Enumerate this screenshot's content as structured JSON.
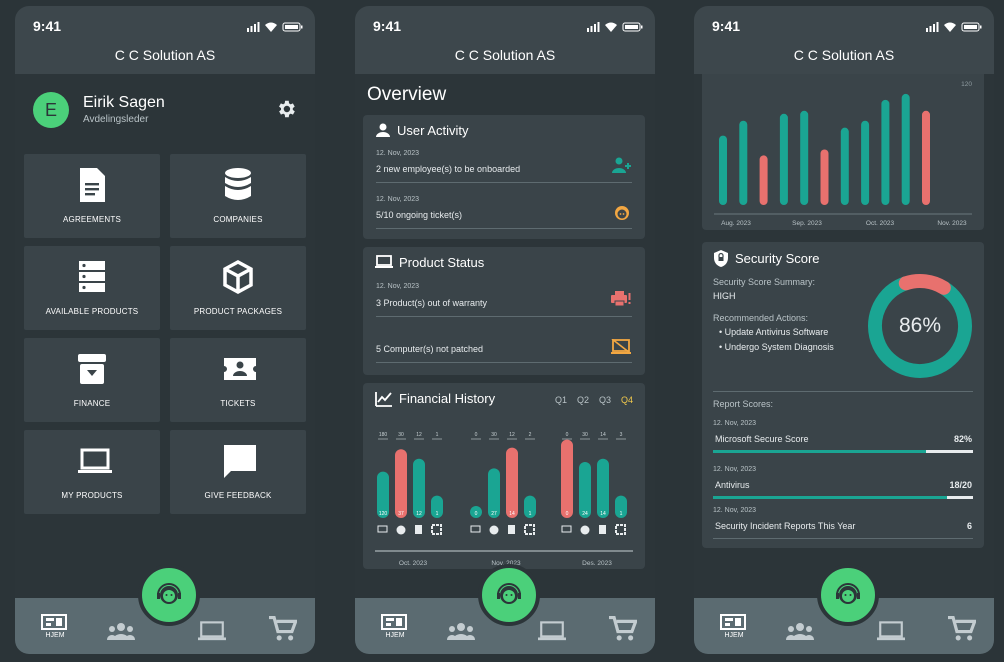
{
  "status": {
    "time": "9:41"
  },
  "header": {
    "company": "C C Solution AS"
  },
  "nav": {
    "home_label": "HJEM"
  },
  "colors": {
    "accent": "#1aa593",
    "alert": "#e8716e",
    "fab": "#4bd07a",
    "icon_warn": "#f2a742"
  },
  "screen1": {
    "user": {
      "initial": "E",
      "name": "Eirik Sagen",
      "role": "Avdelingsleder"
    },
    "tiles": [
      {
        "label": "AGREEMENTS",
        "icon": "document-icon"
      },
      {
        "label": "COMPANIES",
        "icon": "database-icon"
      },
      {
        "label": "AVAILABLE PRODUCTS",
        "icon": "server-icon"
      },
      {
        "label": "PRODUCT PACKAGES",
        "icon": "package-icon"
      },
      {
        "label": "FINANCE",
        "icon": "archive-icon"
      },
      {
        "label": "TICKETS",
        "icon": "ticket-icon"
      },
      {
        "label": "MY PRODUCTS",
        "icon": "laptop-icon"
      },
      {
        "label": "GIVE FEEDBACK",
        "icon": "chat-icon"
      }
    ]
  },
  "screen2": {
    "title": "Overview",
    "user_activity": {
      "title": "User Activity",
      "items": [
        {
          "date": "12. Nov, 2023",
          "text": "2 new employee(s) to be onboarded"
        },
        {
          "date": "12. Nov, 2023",
          "text": "5/10 ongoing ticket(s)"
        }
      ]
    },
    "product_status": {
      "title": "Product Status",
      "items": [
        {
          "date": "12. Nov, 2023",
          "text": "3 Product(s) out of warranty"
        },
        {
          "date": "",
          "text": "5 Computer(s) not patched"
        }
      ]
    },
    "financial": {
      "title": "Financial History",
      "quarters": [
        "Q1",
        "Q2",
        "Q3",
        "Q4"
      ],
      "active_quarter": "Q4",
      "months": [
        "Oct. 2023",
        "Nov. 2023",
        "Des. 2023"
      ],
      "groups": [
        {
          "tops": [
            "180",
            "30",
            "12",
            "1"
          ],
          "bottoms": [
            "120",
            "37",
            "12",
            "1"
          ],
          "heights": [
            0.58,
            0.86,
            0.74,
            0.28
          ],
          "colors": [
            "t",
            "r",
            "t",
            "t"
          ]
        },
        {
          "tops": [
            "0",
            "30",
            "12",
            "2"
          ],
          "bottoms": [
            "0",
            "27",
            "14",
            "1"
          ],
          "heights": [
            0.05,
            0.62,
            0.88,
            0.28
          ],
          "colors": [
            "t",
            "t",
            "r",
            "t"
          ]
        },
        {
          "tops": [
            "0",
            "30",
            "14",
            "3"
          ],
          "bottoms": [
            "0",
            "24",
            "14",
            "1"
          ],
          "heights": [
            0.98,
            0.7,
            0.74,
            0.28
          ],
          "colors": [
            "r",
            "t",
            "t",
            "t"
          ]
        }
      ]
    }
  },
  "screen3": {
    "chart_data": {
      "type": "bar",
      "ylim": [
        0,
        120
      ],
      "ytick": "120",
      "x_labels": [
        "Aug. 2023",
        "Sep. 2023",
        "Oct. 2023",
        "Nov. 2023"
      ],
      "values": [
        70,
        85,
        50,
        92,
        95,
        56,
        78,
        85,
        106,
        112,
        95
      ],
      "colors": [
        "t",
        "t",
        "r",
        "t",
        "t",
        "r",
        "t",
        "t",
        "t",
        "t",
        "r"
      ]
    },
    "security": {
      "title": "Security Score",
      "summary_label": "Security Score Summary:",
      "summary_value": "HIGH",
      "actions_label": "Recommended Actions:",
      "actions": [
        "Update Antivirus Software",
        "Undergo System Diagnosis"
      ],
      "score_text": "86%",
      "score_fraction": 0.86,
      "report_label": "Report Scores:",
      "reports": [
        {
          "date": "12. Nov, 2023",
          "name": "Microsoft Secure Score",
          "value": "82%",
          "fraction": 0.82
        },
        {
          "date": "12. Nov, 2023",
          "name": "Antivirus",
          "value": "18/20",
          "fraction": 0.9
        },
        {
          "date": "12. Nov, 2023",
          "name": "Security Incident Reports This Year",
          "value": "6"
        }
      ]
    }
  }
}
